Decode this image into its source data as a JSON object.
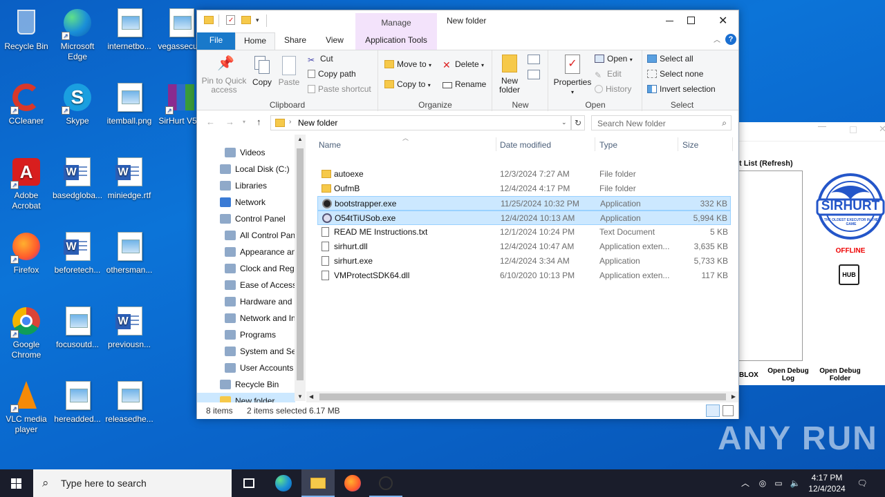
{
  "desktop": {
    "icons": [
      {
        "label1": "Recycle Bin",
        "label2": ""
      },
      {
        "label1": "Microsoft",
        "label2": "Edge"
      },
      {
        "label1": "internetbo...",
        "label2": ""
      },
      {
        "label1": "vegassecu...",
        "label2": ""
      },
      {
        "label1": "CCleaner",
        "label2": ""
      },
      {
        "label1": "Skype",
        "label2": ""
      },
      {
        "label1": "itemball.png",
        "label2": ""
      },
      {
        "label1": "SirHurt V5...",
        "label2": ""
      },
      {
        "label1": "Adobe",
        "label2": "Acrobat"
      },
      {
        "label1": "basedgloba...",
        "label2": ""
      },
      {
        "label1": "miniedge.rtf",
        "label2": ""
      },
      {
        "label1": "Firefox",
        "label2": ""
      },
      {
        "label1": "beforetech...",
        "label2": ""
      },
      {
        "label1": "othersman...",
        "label2": ""
      },
      {
        "label1": "Google",
        "label2": "Chrome"
      },
      {
        "label1": "focusoutd...",
        "label2": ""
      },
      {
        "label1": "previousn...",
        "label2": ""
      },
      {
        "label1": "VLC media",
        "label2": "player"
      },
      {
        "label1": "hereadded...",
        "label2": ""
      },
      {
        "label1": "releasedhe...",
        "label2": ""
      }
    ]
  },
  "explorer": {
    "title": "New folder",
    "contextual_tab": "Manage",
    "tabs": [
      "File",
      "Home",
      "Share",
      "View",
      "Application Tools"
    ],
    "clipboard": {
      "pin": "Pin to Quick",
      "pin2": "access",
      "copy": "Copy",
      "paste": "Paste",
      "cut": "Cut",
      "copy_path": "Copy path",
      "paste_shortcut": "Paste shortcut",
      "label": "Clipboard"
    },
    "organize": {
      "move_to": "Move to",
      "delete": "Delete",
      "copy_to": "Copy to",
      "rename": "Rename",
      "label": "Organize"
    },
    "new": {
      "new_folder": "New",
      "new_folder2": "folder",
      "label": "New"
    },
    "open": {
      "properties": "Properties",
      "open": "Open",
      "edit": "Edit",
      "history": "History",
      "label": "Open"
    },
    "select": {
      "all": "Select all",
      "none": "Select none",
      "invert": "Invert selection",
      "label": "Select"
    },
    "address": {
      "path": "New folder",
      "search_placeholder": "Search New folder"
    },
    "nav": [
      "Videos",
      "Local Disk (C:)",
      "Libraries",
      "Network",
      "Control Panel",
      "All Control Panel Items",
      "Appearance and Personalization",
      "Clock and Region",
      "Ease of Access",
      "Hardware and Sound",
      "Network and Internet",
      "Programs",
      "System and Security",
      "User Accounts",
      "Recycle Bin",
      "New folder"
    ],
    "columns": {
      "name": "Name",
      "date": "Date modified",
      "type": "Type",
      "size": "Size"
    },
    "files": [
      {
        "name": "autoexe",
        "date": "12/3/2024 7:27 AM",
        "type": "File folder",
        "size": "",
        "kind": "folder",
        "selected": false
      },
      {
        "name": "OufmB",
        "date": "12/4/2024 4:17 PM",
        "type": "File folder",
        "size": "",
        "kind": "folder",
        "selected": false
      },
      {
        "name": "bootstrapper.exe",
        "date": "11/25/2024 10:32 PM",
        "type": "Application",
        "size": "332 KB",
        "kind": "exe-dark",
        "selected": true
      },
      {
        "name": "O54tTiUSob.exe",
        "date": "12/4/2024 10:13 AM",
        "type": "Application",
        "size": "5,994 KB",
        "kind": "exe-gear",
        "selected": true
      },
      {
        "name": "READ ME Instructions.txt",
        "date": "12/1/2024 10:24 PM",
        "type": "Text Document",
        "size": "5 KB",
        "kind": "txt",
        "selected": false
      },
      {
        "name": "sirhurt.dll",
        "date": "12/4/2024 10:47 AM",
        "type": "Application exten...",
        "size": "3,635 KB",
        "kind": "dll",
        "selected": false
      },
      {
        "name": "sirhurt.exe",
        "date": "12/4/2024 3:34 AM",
        "type": "Application",
        "size": "5,733 KB",
        "kind": "exe",
        "selected": false
      },
      {
        "name": "VMProtectSDK64.dll",
        "date": "6/10/2020 10:13 PM",
        "type": "Application exten...",
        "size": "117 KB",
        "kind": "dll",
        "selected": false
      }
    ],
    "status": {
      "count": "8 items",
      "selected": "2 items selected",
      "size": "6.17 MB"
    }
  },
  "background_app": {
    "header": "t List (Refresh)",
    "logo_text": "SIRHURT",
    "logo_ring": "THE OLDEST EXECUTOR IN THE GAME",
    "status": "OFFLINE",
    "hub": "HUB",
    "btn_left": "BLOX",
    "btn_debug_log": "Open Debug Log",
    "btn_debug_folder": "Open Debug Folder"
  },
  "taskbar": {
    "search_placeholder": "Type here to search",
    "time": "4:17 PM",
    "date": "12/4/2024"
  },
  "watermark": "ANY RUN"
}
